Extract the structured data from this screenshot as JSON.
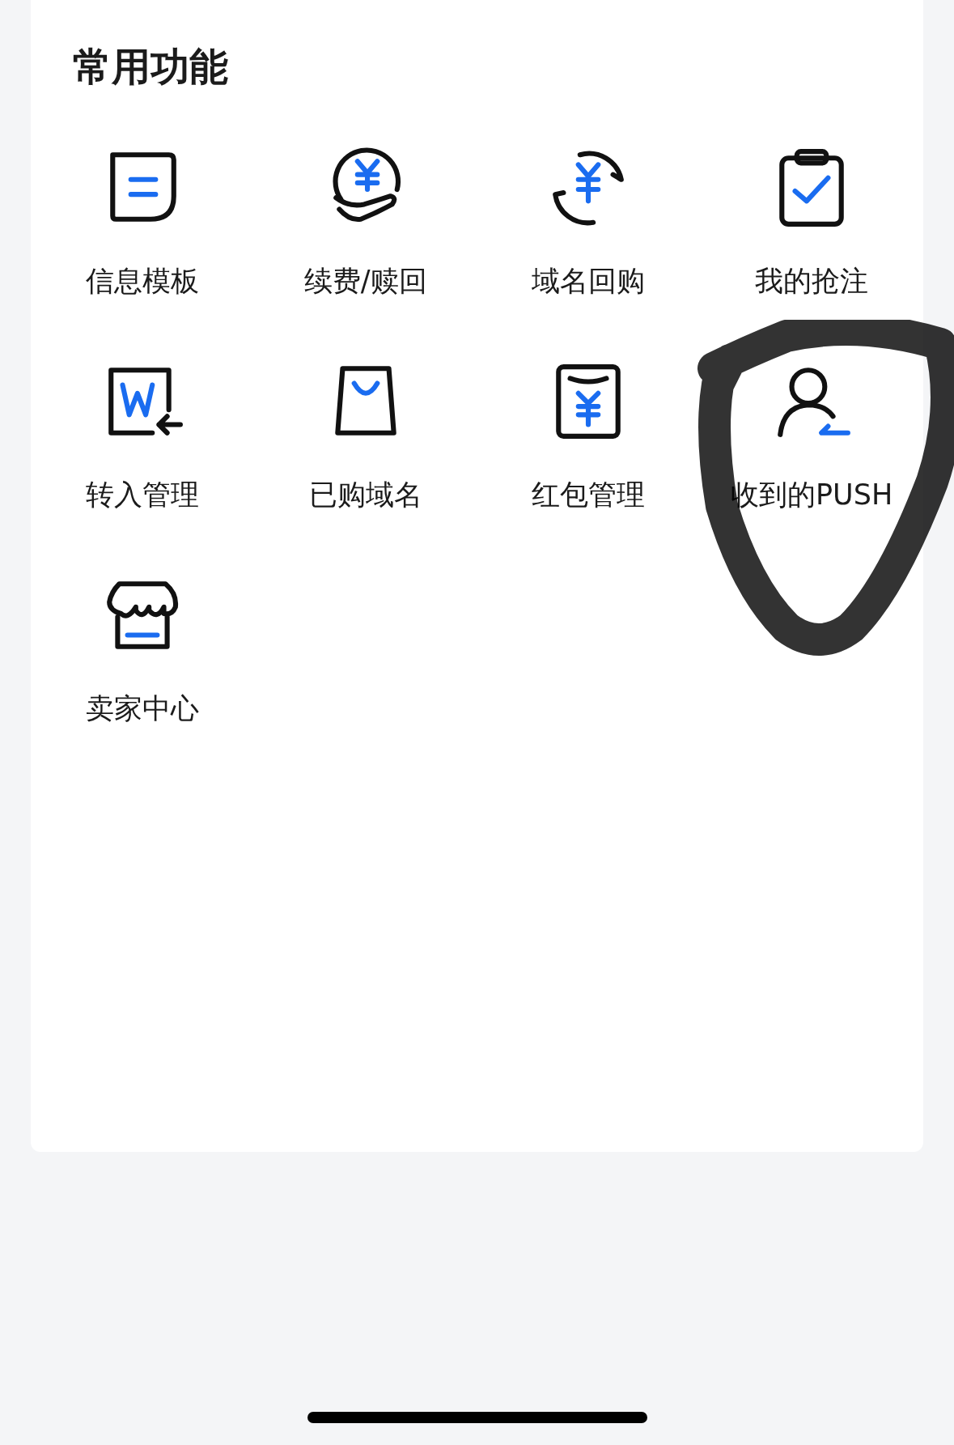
{
  "section": {
    "title": "常用功能"
  },
  "items": [
    {
      "label": "信息模板"
    },
    {
      "label": "续费/赎回"
    },
    {
      "label": "域名回购"
    },
    {
      "label": "我的抢注"
    },
    {
      "label": "转入管理"
    },
    {
      "label": "已购域名"
    },
    {
      "label": "红包管理"
    },
    {
      "label": "收到的PUSH"
    },
    {
      "label": "卖家中心"
    }
  ]
}
